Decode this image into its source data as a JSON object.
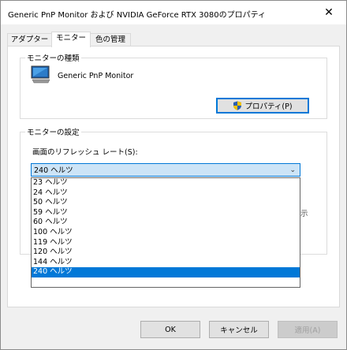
{
  "window": {
    "title": "Generic PnP Monitor および NVIDIA GeForce RTX 3080のプロパティ",
    "close_glyph": "✕"
  },
  "tabs": [
    {
      "label": "アダプター",
      "active": false
    },
    {
      "label": "モニター",
      "active": true
    },
    {
      "label": "色の管理",
      "active": false
    }
  ],
  "monitor_type_group": {
    "label": "モニターの種類",
    "monitor_name": "Generic PnP Monitor",
    "properties_button": "プロパティ(P)"
  },
  "monitor_settings_group": {
    "label": "モニターの設定",
    "refresh_label": "画面のリフレッシュ レート(S):",
    "selected_value": "240 ヘルツ",
    "options": [
      "23 ヘルツ",
      "24 ヘルツ",
      "50 ヘルツ",
      "59 ヘルツ",
      "60 ヘルツ",
      "100 ヘルツ",
      "119 ヘルツ",
      "120 ヘルツ",
      "144 ヘルツ",
      "240 ヘルツ"
    ],
    "partially_hidden_text": "示"
  },
  "footer": {
    "ok": "OK",
    "cancel": "キャンセル",
    "apply": "適用(A)"
  },
  "colors": {
    "accent": "#0078d7",
    "selection_bg": "#cce4f7"
  }
}
